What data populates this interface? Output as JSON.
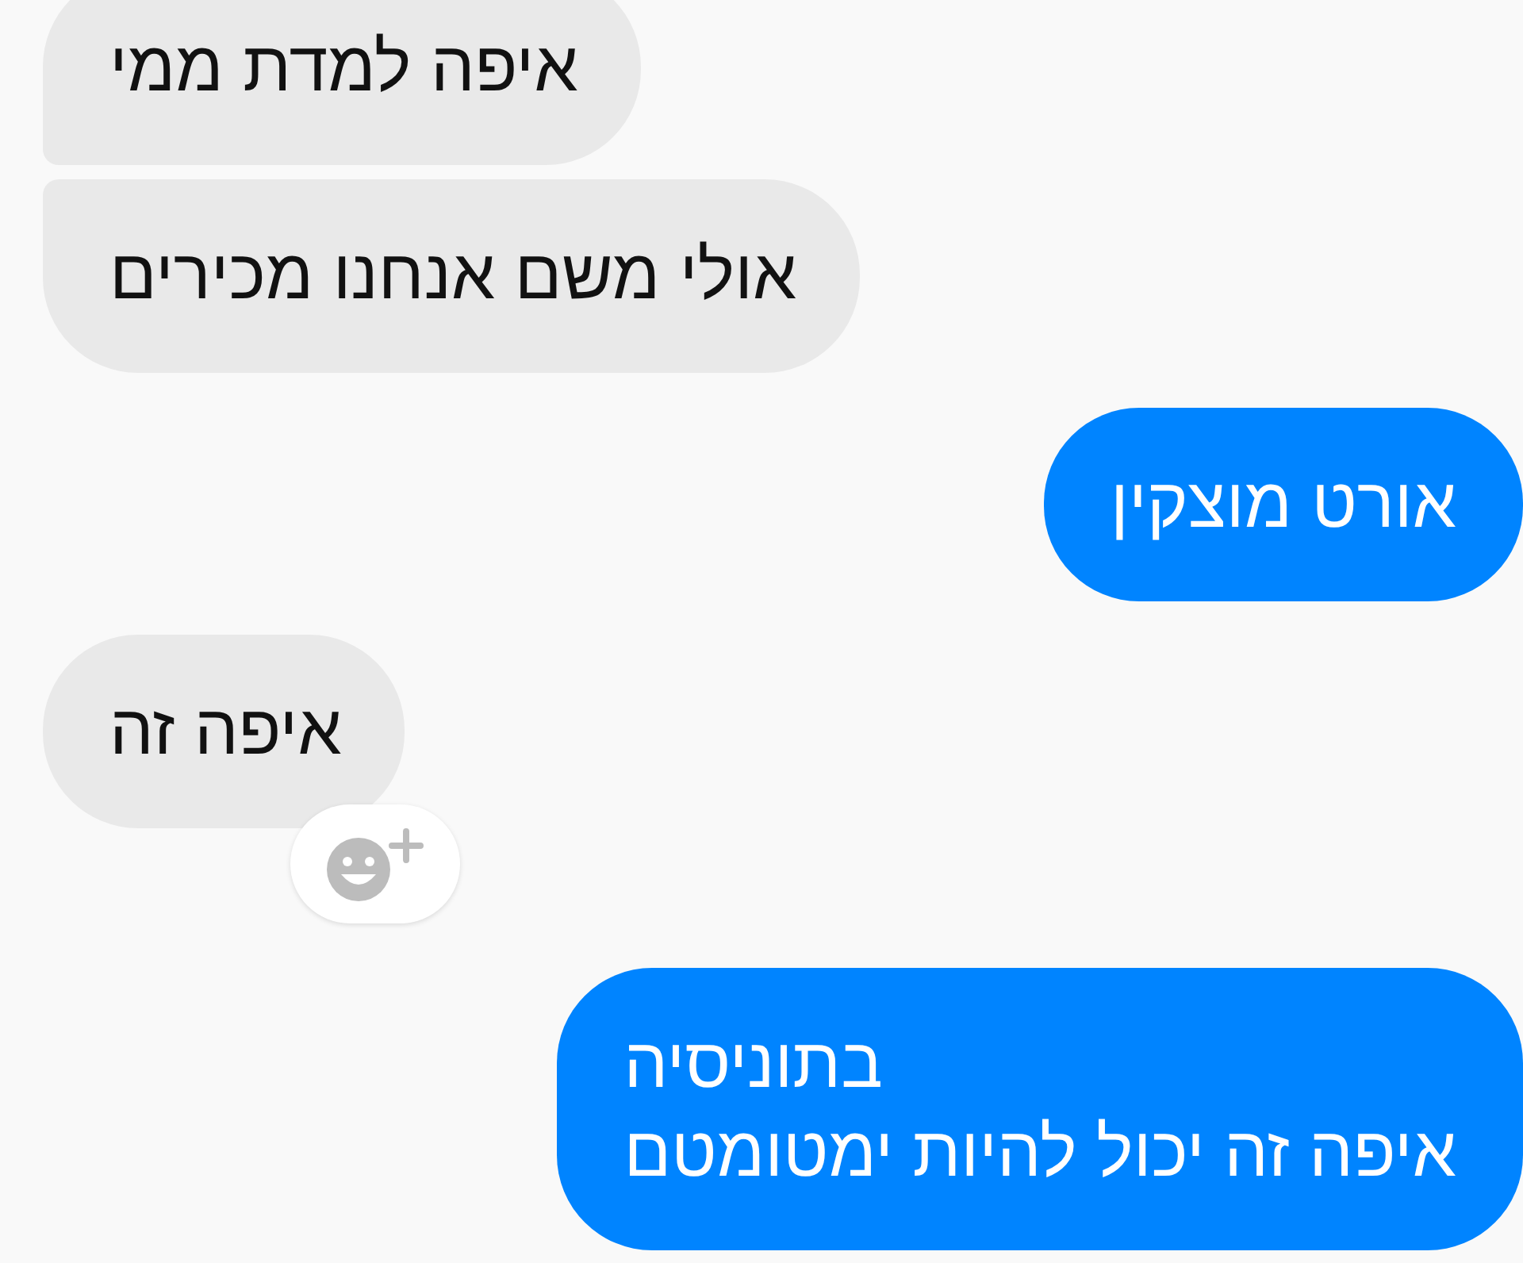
{
  "messages": [
    {
      "kind": "incoming",
      "text": "איפה למדת ממי",
      "reaction_button": false
    },
    {
      "kind": "incoming",
      "text": "אולי משם אנחנו מכירים",
      "reaction_button": false
    },
    {
      "kind": "outgoing",
      "text": "אורט מוצקין",
      "reaction_button": false
    },
    {
      "kind": "incoming",
      "text": "איפה זה",
      "reaction_button": true
    },
    {
      "kind": "outgoing",
      "text": "בתוניסיה\nאיפה זה יכול להיות ימטומטם",
      "reaction_button": false
    }
  ]
}
